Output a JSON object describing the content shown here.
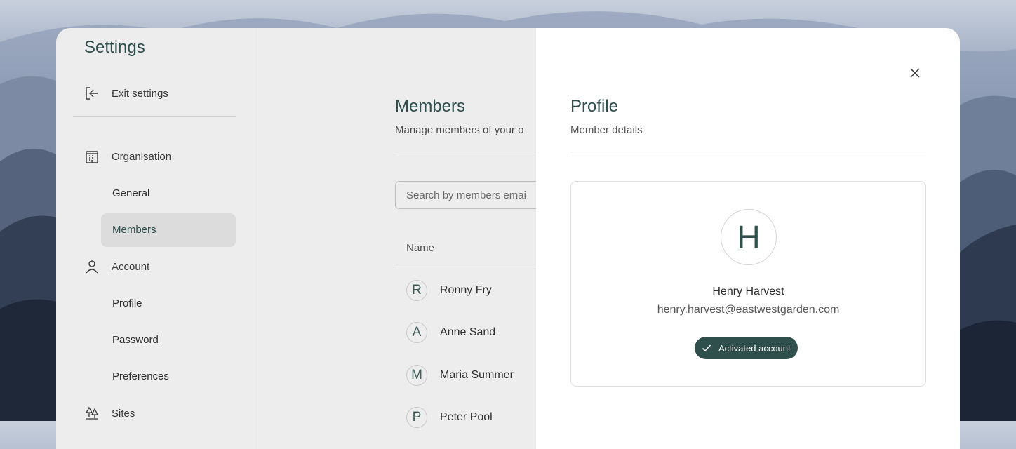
{
  "sidebar": {
    "title": "Settings",
    "exit_label": "Exit settings",
    "sections": [
      {
        "label": "Organisation",
        "icon": "building-icon",
        "items": [
          "General",
          "Members"
        ]
      },
      {
        "label": "Account",
        "icon": "user-icon",
        "items": [
          "Profile",
          "Password",
          "Preferences"
        ]
      },
      {
        "label": "Sites",
        "icon": "trees-icon",
        "items": []
      }
    ],
    "active_item": "Members"
  },
  "main": {
    "title": "Members",
    "subtitle": "Manage members of your o",
    "search_placeholder": "Search by members emai",
    "column_name": "Name",
    "members": [
      {
        "initial": "R",
        "name": "Ronny Fry"
      },
      {
        "initial": "A",
        "name": "Anne Sand"
      },
      {
        "initial": "M",
        "name": "Maria Summer"
      },
      {
        "initial": "P",
        "name": "Peter Pool"
      }
    ]
  },
  "panel": {
    "title": "Profile",
    "subtitle": "Member details",
    "initial": "H",
    "name": "Henry Harvest",
    "email": "henry.harvest@eastwestgarden.com",
    "badge": "Activated account",
    "close_icon": "close-icon"
  },
  "colors": {
    "accent": "#2f4f4c",
    "panel_bg": "#ffffff",
    "window_bg": "#ededed"
  }
}
